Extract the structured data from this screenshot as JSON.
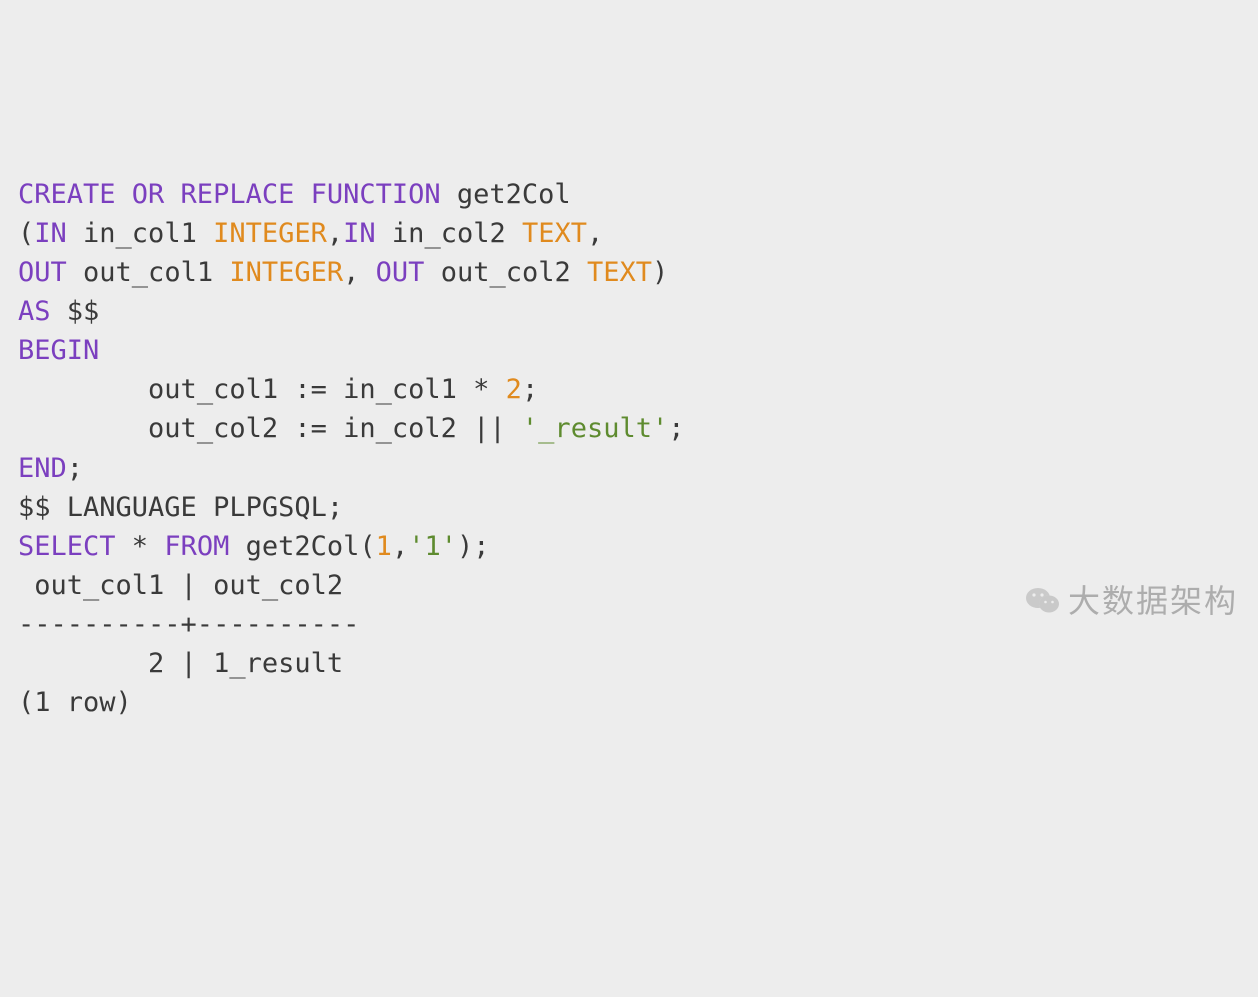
{
  "code": {
    "l1": {
      "kw": "CREATE OR REPLACE FUNCTION",
      "name": " get2Col"
    },
    "l2": {
      "a": "(",
      "kw1": "IN",
      "b": " in_col1 ",
      "ty1": "INTEGER",
      "c": ",",
      "kw2": "IN",
      "d": " in_col2 ",
      "ty2": "TEXT",
      "e": ","
    },
    "l3": {
      "kw1": "OUT",
      "a": " out_col1 ",
      "ty1": "INTEGER",
      "b": ", ",
      "kw2": "OUT",
      "c": " out_col2 ",
      "ty2": "TEXT",
      "d": ")"
    },
    "l4": {
      "kw": "AS",
      "rest": " $$"
    },
    "l5": {
      "kw": "BEGIN"
    },
    "l6": {
      "indent": "        ",
      "a": "out_col1 := in_col1 * ",
      "num": "2",
      "b": ";"
    },
    "l7": {
      "indent": "        ",
      "a": "out_col2 := in_col2 || ",
      "str": "'_result'",
      "b": ";"
    },
    "l8": {
      "kw": "END",
      "b": ";"
    },
    "l9": {
      "a": "$$ LANGUAGE PLPGSQL;"
    },
    "l10": {
      "kw1": "SELECT",
      "a": " * ",
      "kw2": "FROM",
      "b": " get2Col(",
      "num": "1",
      "c": ",",
      "str": "'1'",
      "d": ");"
    }
  },
  "output": {
    "header": " out_col1 | out_col2 ",
    "divider": "----------+----------",
    "row": "        2 | 1_result",
    "footer": "(1 row)"
  },
  "watermark": "大数据架构"
}
